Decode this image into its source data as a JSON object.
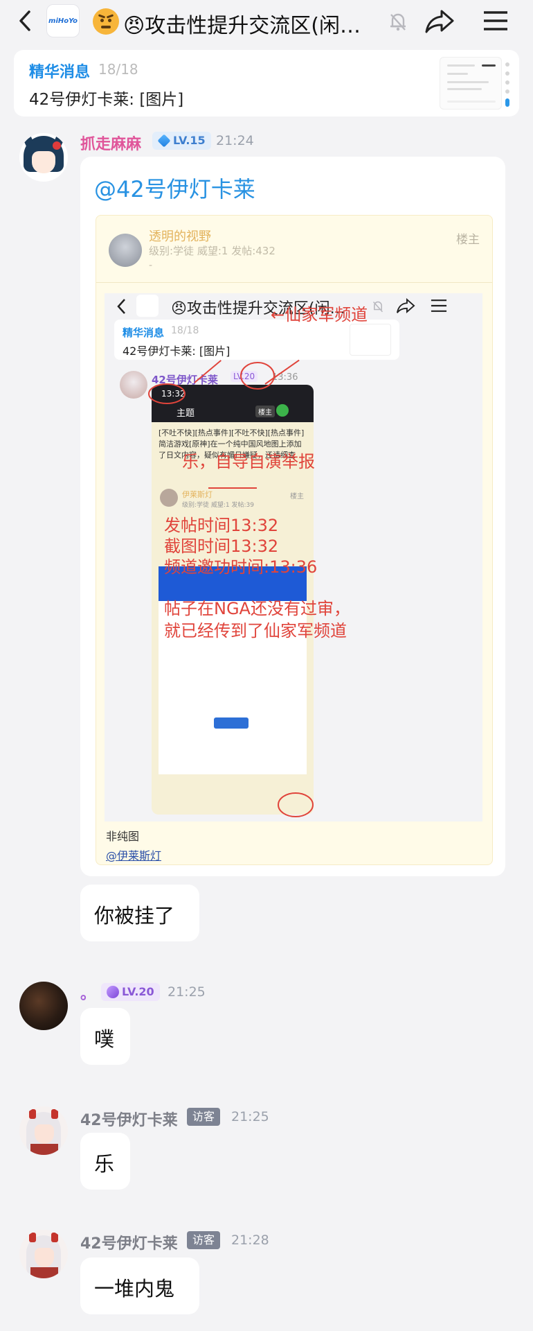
{
  "header": {
    "app_logo": "miHoYo",
    "title": "😠攻击性提升交流区(闲…"
  },
  "essence": {
    "label": "精华消息",
    "count": "18/18",
    "text": "42号伊灯卡莱: [图片]"
  },
  "messages": [
    {
      "name": "抓走麻麻",
      "level": "LV.15",
      "time": "21:24",
      "mention": "@42号伊灯卡莱",
      "post": {
        "author": "透明的视野",
        "meta": "级别:学徒 威望:1 发帖:432",
        "dash": "-",
        "owner": "楼主",
        "caption": "非纯图",
        "link": "@伊莱斯灯",
        "screenshot": {
          "title": "😠攻击性提升交流区(闲…",
          "essence_label": "精华消息",
          "essence_count": "18/18",
          "essence_text": "42号伊灯卡莱: [图片]",
          "poster": "42号伊灯卡莱",
          "poster_level": "LV.20",
          "poster_time": "13:36",
          "phone_time": "13:32",
          "phone_header": "主题",
          "phone_owner_tag": "楼主",
          "phone_body": "[不吐不快][热点事件][不吐不快][热点事件]简洁游戏[原神]在一个纯中国风地图上添加了日文内容，疑似有媚日嫌疑，还请细查",
          "phone_user": "伊莱斯灯",
          "phone_user_meta": "级别:学徒 威望:1 发帖:39",
          "phone_user_owner": "楼主",
          "annotations": [
            "←仙家军频道",
            "乐，自导自演举报",
            "发帖时间13:32",
            "截图时间13:32",
            "频道邀功时间:13:36",
            "帖子在NGA还没有过审，",
            "就已经传到了仙家军频道"
          ]
        }
      },
      "reply": "你被挂了"
    },
    {
      "name": "。",
      "level": "LV.20",
      "time": "21:25",
      "text": "噗"
    },
    {
      "name": "42号伊灯卡莱",
      "badge": "访客",
      "time": "21:25",
      "text": "乐"
    },
    {
      "name": "42号伊灯卡莱",
      "badge": "访客",
      "time": "21:28",
      "text": "一堆内鬼"
    }
  ]
}
